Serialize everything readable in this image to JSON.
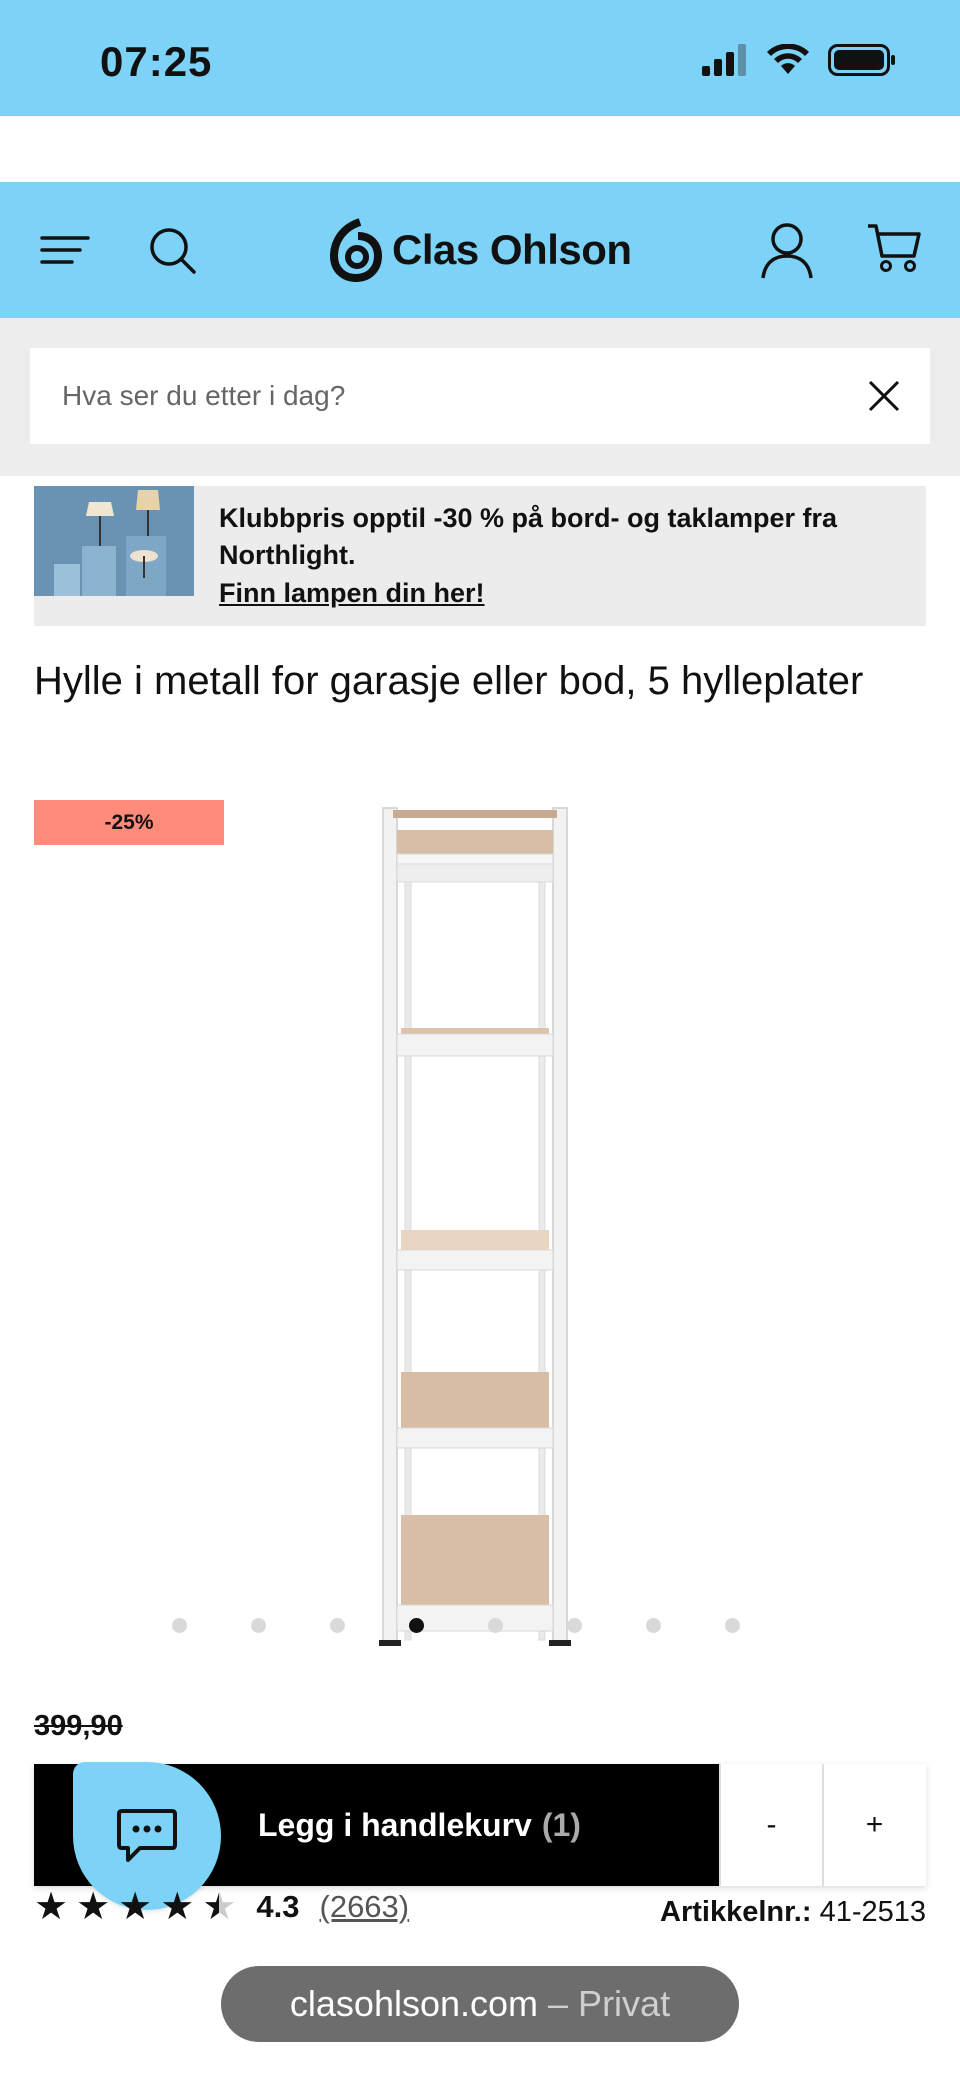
{
  "status_bar": {
    "time": "07:25"
  },
  "header": {
    "brand": "Clas Ohlson"
  },
  "search": {
    "placeholder": "Hva ser du etter i dag?"
  },
  "promo": {
    "text": "Klubbpris opptil -30 % på bord- og taklamper fra Northlight.",
    "link": "Finn lampen din her!"
  },
  "product": {
    "title": "Hylle i metall for garasje eller bod, 5 hylleplater",
    "discount_badge": "-25%",
    "old_price": "399,90",
    "image_count": 8,
    "active_image": 4,
    "rating": "4.3",
    "rating_value": 4.3,
    "review_count": "(2663)",
    "article_label": "Artikkelnr.:",
    "article_number": "41-2513"
  },
  "cart": {
    "label": "Legg i handlekurv",
    "count": "(1)",
    "minus": "-",
    "plus": "+"
  },
  "browser": {
    "domain": "clasohlson.com",
    "mode": "– Privat"
  },
  "colors": {
    "brand_blue": "#7dd3f7",
    "discount": "#ff8b7b",
    "black": "#000000"
  }
}
